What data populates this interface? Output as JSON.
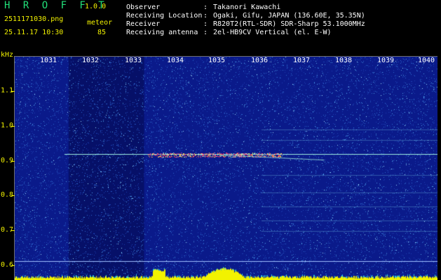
{
  "header": {
    "app_title": "H R O F F T",
    "version": "1.0.0",
    "filename": "2511171030.png",
    "datetime": "25.11.17 10:30",
    "mode_label": "meteor",
    "count": "85",
    "info": [
      {
        "key": "Observer",
        "value": "Takanori Kawachi"
      },
      {
        "key": "Receiving Location",
        "value": "Ogaki, Gifu, JAPAN (136.60E, 35.35N)"
      },
      {
        "key": "Receiver",
        "value": "R820T2(RTL-SDR) SDR-Sharp 53.1000MHz"
      },
      {
        "key": "Receiving antenna",
        "value": "2el-HB9CV Vertical (el. E-W)"
      }
    ]
  },
  "chart_data": {
    "type": "heatmap",
    "ylabel": "kHz",
    "y_ticks": [
      "1.1",
      "1.0",
      "0.9",
      "0.8",
      "0.7",
      "0.6"
    ],
    "x_ticks": [
      "1031",
      "1032",
      "1033",
      "1034",
      "1035",
      "1036",
      "1037",
      "1038",
      "1039",
      "1040"
    ],
    "ylim": [
      0.58,
      1.18
    ],
    "xlim": [
      1030.6,
      1040.4
    ],
    "carrier_frequency_khz": 0.92,
    "background_color": "#0a1a8a",
    "colors": {
      "carrier": "#9ff0e0",
      "echo": "#ff3b6b",
      "noise": "#2f6bd0"
    }
  }
}
